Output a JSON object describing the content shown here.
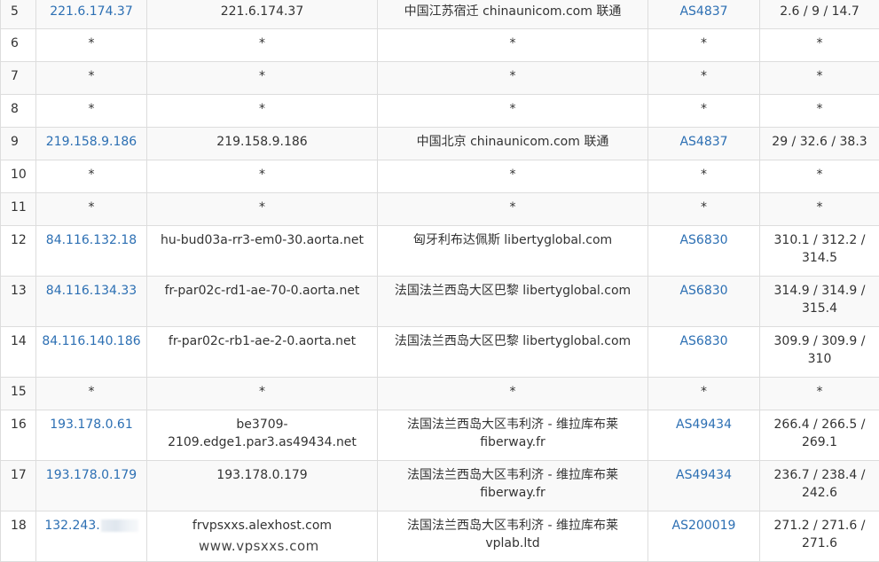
{
  "rows": [
    {
      "hop": "5",
      "ip": "221.6.174.37",
      "hostname": "221.6.174.37",
      "location": "中国江苏宿迁 chinaunicom.com 联通",
      "asn": "AS4837",
      "latency": "2.6 / 9 / 14.7"
    },
    {
      "hop": "6",
      "ip": "*",
      "hostname": "*",
      "location": "*",
      "asn": "*",
      "latency": "*"
    },
    {
      "hop": "7",
      "ip": "*",
      "hostname": "*",
      "location": "*",
      "asn": "*",
      "latency": "*"
    },
    {
      "hop": "8",
      "ip": "*",
      "hostname": "*",
      "location": "*",
      "asn": "*",
      "latency": "*"
    },
    {
      "hop": "9",
      "ip": "219.158.9.186",
      "hostname": "219.158.9.186",
      "location": "中国北京 chinaunicom.com 联通",
      "asn": "AS4837",
      "latency": "29 / 32.6 / 38.3"
    },
    {
      "hop": "10",
      "ip": "*",
      "hostname": "*",
      "location": "*",
      "asn": "*",
      "latency": "*"
    },
    {
      "hop": "11",
      "ip": "*",
      "hostname": "*",
      "location": "*",
      "asn": "*",
      "latency": "*"
    },
    {
      "hop": "12",
      "ip": "84.116.132.18",
      "hostname": "hu-bud03a-rr3-em0-30.aorta.net",
      "location": "匈牙利布达佩斯 libertyglobal.com",
      "asn": "AS6830",
      "latency_1": "310.1 / 312.2 /",
      "latency_2": "314.5"
    },
    {
      "hop": "13",
      "ip": "84.116.134.33",
      "hostname": "fr-par02c-rd1-ae-70-0.aorta.net",
      "location": "法国法兰西岛大区巴黎 libertyglobal.com",
      "asn": "AS6830",
      "latency_1": "314.9 / 314.9 /",
      "latency_2": "315.4"
    },
    {
      "hop": "14",
      "ip": "84.116.140.186",
      "hostname": "fr-par02c-rb1-ae-2-0.aorta.net",
      "location": "法国法兰西岛大区巴黎 libertyglobal.com",
      "asn": "AS6830",
      "latency_1": "309.9 / 309.9 /",
      "latency_2": "310"
    },
    {
      "hop": "15",
      "ip": "*",
      "hostname": "*",
      "location": "*",
      "asn": "*",
      "latency": "*"
    },
    {
      "hop": "16",
      "ip": "193.178.0.61",
      "hostname_1": "be3709-",
      "hostname_2": "2109.edge1.par3.as49434.net",
      "location_1": "法国法兰西岛大区韦利济 - 维拉库布莱",
      "location_2": "fiberway.fr",
      "asn": "AS49434",
      "latency_1": "266.4 / 266.5 /",
      "latency_2": "269.1"
    },
    {
      "hop": "17",
      "ip": "193.178.0.179",
      "hostname": "193.178.0.179",
      "location_1": "法国法兰西岛大区韦利济 - 维拉库布莱",
      "location_2": "fiberway.fr",
      "asn": "AS49434",
      "latency_1": "236.7 / 238.4 /",
      "latency_2": "242.6"
    },
    {
      "hop": "18",
      "ip": "132.243.",
      "hostname": "frvpsxxs.alexhost.com",
      "location_1": "法国法兰西岛大区韦利济 - 维拉库布莱",
      "location_2": "vplab.ltd",
      "asn": "AS200019",
      "latency_1": "271.2 / 271.6 /",
      "latency_2": "271.6"
    }
  ],
  "watermark": "www.vpsxxs.com"
}
